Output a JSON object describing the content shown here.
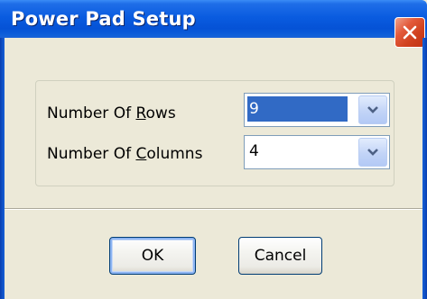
{
  "window": {
    "title": "Power Pad Setup",
    "close_glyph": "✕"
  },
  "form": {
    "rows_label_prefix": "Number Of ",
    "rows_label_mnemonic": "R",
    "rows_label_suffix": "ows",
    "rows_value": "9",
    "columns_label_prefix": "Number Of ",
    "columns_label_mnemonic": "C",
    "columns_label_suffix": "olumns",
    "columns_value": "4"
  },
  "buttons": {
    "ok_label": "OK",
    "cancel_label": "Cancel"
  },
  "icons": {
    "close": "close-icon",
    "dropdown": "chevron-down-icon"
  },
  "colors": {
    "titlebar": "#0a5ce0",
    "close_button": "#d0411f",
    "selection": "#316ac5",
    "dialog_background": "#ece9d8"
  }
}
